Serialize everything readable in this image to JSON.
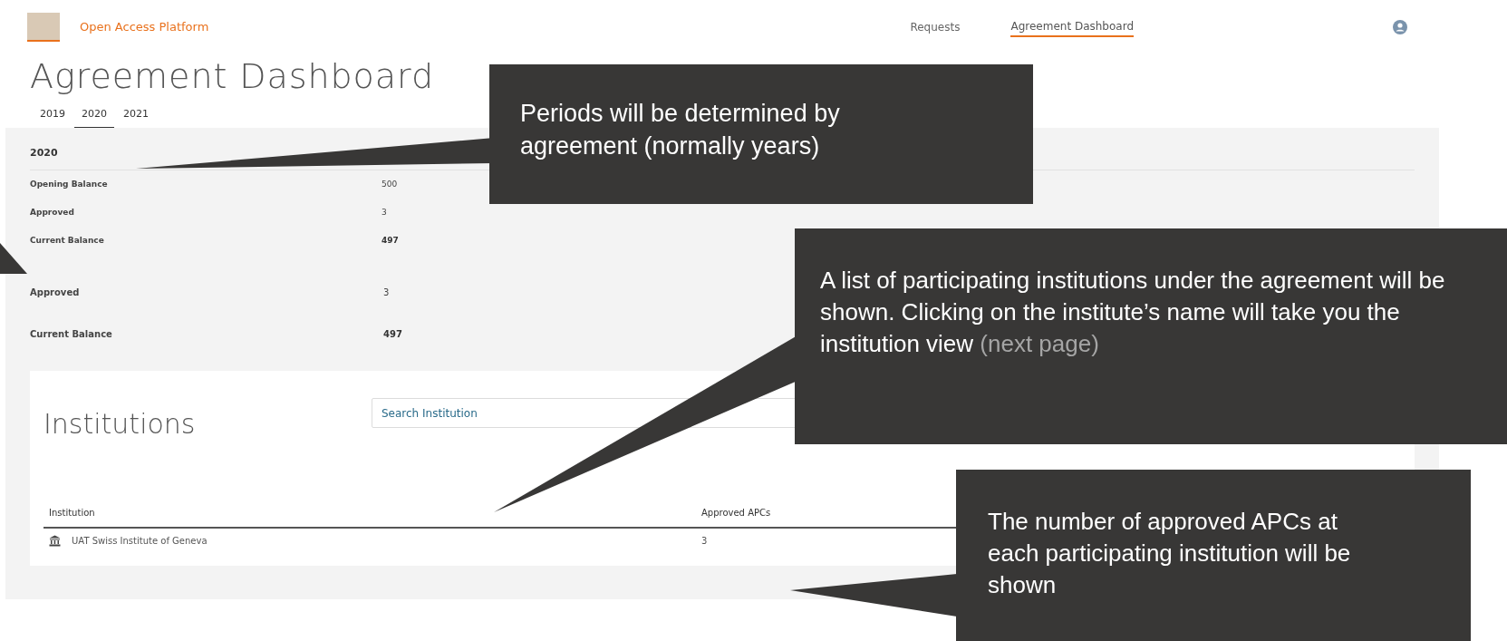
{
  "header": {
    "brand": "Open Access Platform",
    "nav": [
      {
        "label": "Requests",
        "selected": false
      },
      {
        "label": "Agreement Dashboard",
        "selected": true
      }
    ]
  },
  "page_title": "Agreement Dashboard",
  "tabs": [
    {
      "label": "2019",
      "selected": false
    },
    {
      "label": "2020",
      "selected": true
    },
    {
      "label": "2021",
      "selected": false
    }
  ],
  "period": {
    "title": "2020",
    "rows": [
      {
        "label": "Opening Balance",
        "value": "500",
        "bold": false
      },
      {
        "label": "Approved",
        "value": "3",
        "bold": false
      },
      {
        "label": "Current Balance",
        "value": "497",
        "bold": true
      }
    ]
  },
  "detail_rows": [
    {
      "label": "Approved",
      "value": "3",
      "bold": false
    },
    {
      "label": "Current Balance",
      "value": "497",
      "bold": true
    }
  ],
  "institutions": {
    "title": "Institutions",
    "search": {
      "placeholder": "Search Institution"
    },
    "columns": [
      "Institution",
      "Approved APCs"
    ],
    "rows": [
      {
        "name": "UAT Swiss Institute of Geneva",
        "approved_apcs": "3"
      }
    ]
  },
  "callouts": [
    {
      "text": "Periods will be determined by agreement (normally years)"
    },
    {
      "text": "A list of participating institutions under the agreement will be shown. Clicking on the institute’s name will take you the institution view",
      "aside": "(next page)"
    },
    {
      "text": "The number of approved APCs at each participating institution will be shown"
    }
  ]
}
